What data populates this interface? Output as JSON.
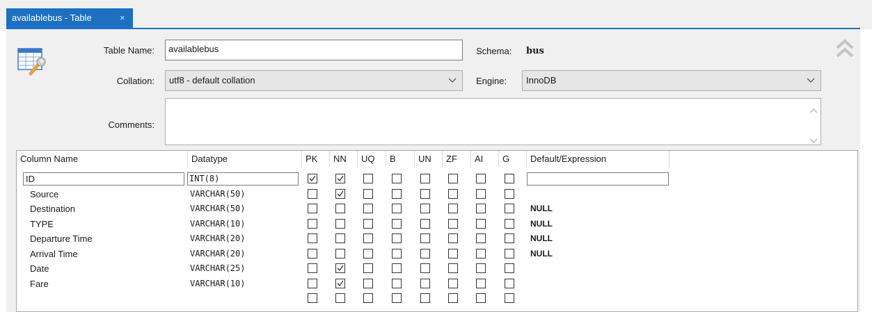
{
  "tab": {
    "title": "availablebus - Table",
    "close_glyph": "×"
  },
  "form": {
    "table_name_label": "Table Name:",
    "table_name_value": "availablebus",
    "schema_label": "Schema:",
    "schema_value": "bus",
    "collation_label": "Collation:",
    "collation_value": "utf8 - default collation",
    "engine_label": "Engine:",
    "engine_value": "InnoDB",
    "comments_label": "Comments:",
    "comments_value": ""
  },
  "icons": {
    "table_icon": "table-wrench-icon",
    "collapse": "double-chevron-up-icon"
  },
  "columns_grid": {
    "headers": [
      "Column Name",
      "Datatype",
      "PK",
      "NN",
      "UQ",
      "B",
      "UN",
      "ZF",
      "AI",
      "G",
      "Default/Expression"
    ],
    "rows": [
      {
        "name": "ID",
        "type": "INT(8)",
        "flags": [
          true,
          true,
          false,
          false,
          false,
          false,
          false,
          false
        ],
        "default": ""
      },
      {
        "name": "Source",
        "type": "VARCHAR(50)",
        "flags": [
          false,
          true,
          false,
          false,
          false,
          false,
          false,
          false
        ],
        "default": ""
      },
      {
        "name": "Destination",
        "type": "VARCHAR(50)",
        "flags": [
          false,
          false,
          false,
          false,
          false,
          false,
          false,
          false
        ],
        "default": "NULL"
      },
      {
        "name": "TYPE",
        "type": "VARCHAR(10)",
        "flags": [
          false,
          false,
          false,
          false,
          false,
          false,
          false,
          false
        ],
        "default": "NULL"
      },
      {
        "name": "Departure Time",
        "type": "VARCHAR(20)",
        "flags": [
          false,
          false,
          false,
          false,
          false,
          false,
          false,
          false
        ],
        "default": "NULL"
      },
      {
        "name": "Arrival Time",
        "type": "VARCHAR(20)",
        "flags": [
          false,
          false,
          false,
          false,
          false,
          false,
          false,
          false
        ],
        "default": "NULL"
      },
      {
        "name": "Date",
        "type": "VARCHAR(25)",
        "flags": [
          false,
          true,
          false,
          false,
          false,
          false,
          false,
          false
        ],
        "default": ""
      },
      {
        "name": "Fare",
        "type": "VARCHAR(10)",
        "flags": [
          false,
          true,
          false,
          false,
          false,
          false,
          false,
          false
        ],
        "default": ""
      },
      {
        "name": "",
        "type": "",
        "flags": [
          false,
          false,
          false,
          false,
          false,
          false,
          false,
          false
        ],
        "default": ""
      }
    ]
  }
}
